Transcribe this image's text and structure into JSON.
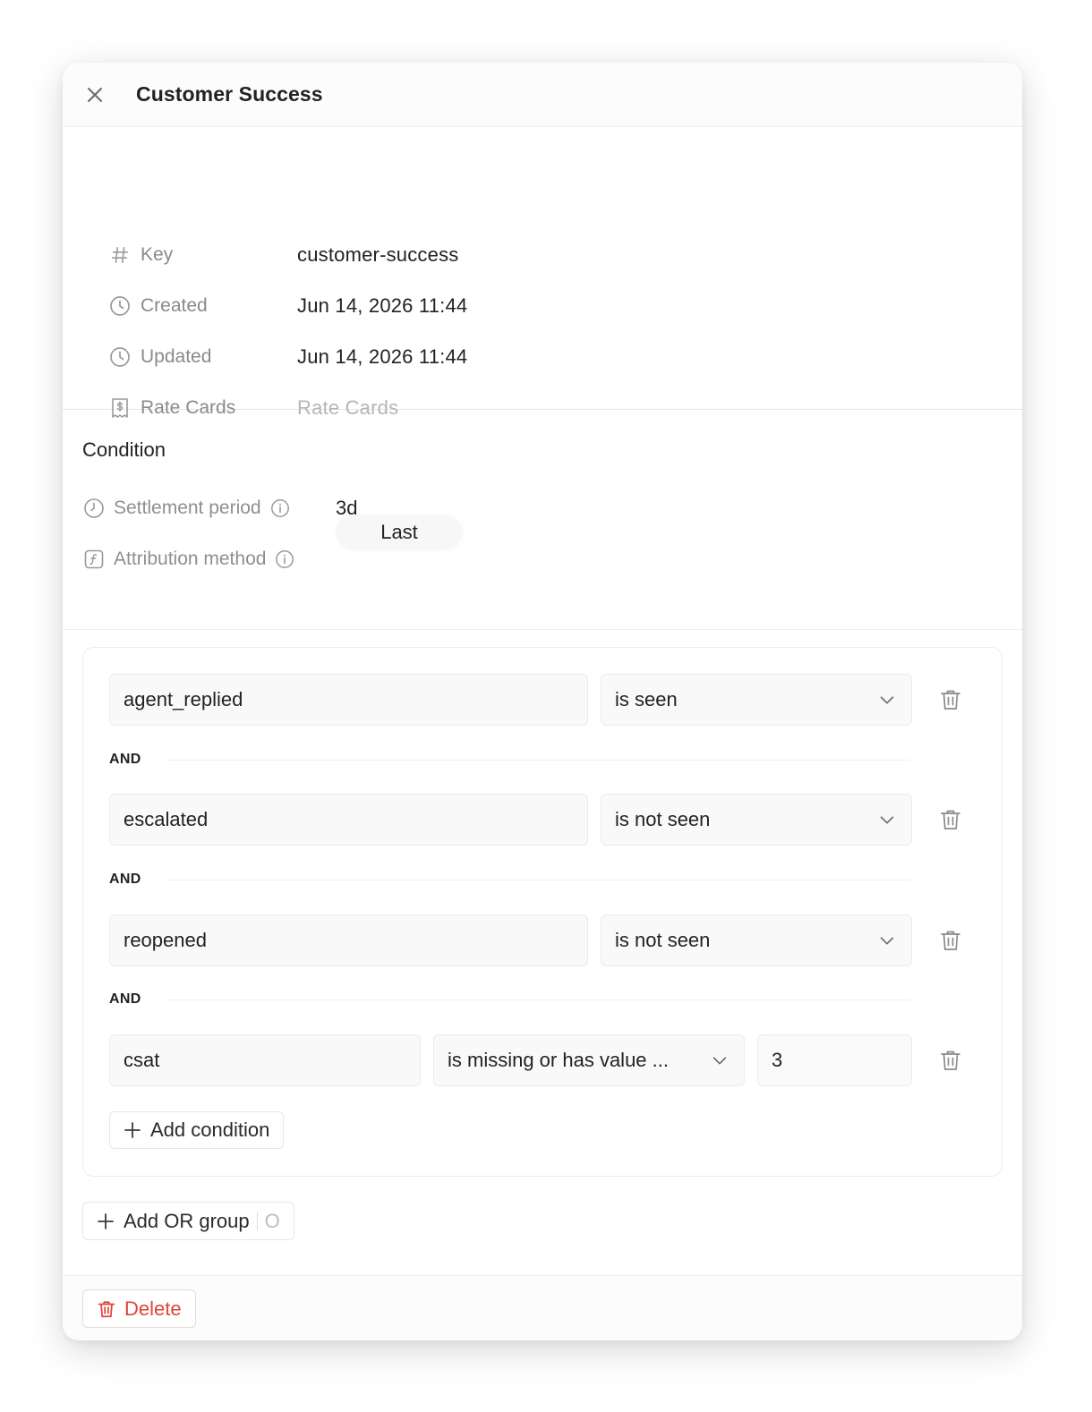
{
  "header": {
    "title": "Customer Success"
  },
  "meta": [
    {
      "icon": "hash-icon",
      "label": "Key",
      "value": "customer-success",
      "placeholder": false
    },
    {
      "icon": "clock-icon",
      "label": "Created",
      "value": "Jun 14, 2026 11:44",
      "placeholder": false
    },
    {
      "icon": "clock-icon",
      "label": "Updated",
      "value": "Jun 14, 2026 11:44",
      "placeholder": false
    },
    {
      "icon": "receipt-icon",
      "label": "Rate Cards",
      "value": "Rate Cards",
      "placeholder": true
    }
  ],
  "condition": {
    "title": "Condition",
    "settlement_label": "Settlement period",
    "settlement_value": "3d",
    "attribution_label": "Attribution method",
    "attribution_value": "Last"
  },
  "group": {
    "rows": [
      {
        "field": "agent_replied",
        "operator": "is seen",
        "value": null
      },
      {
        "field": "escalated",
        "operator": "is not seen",
        "value": null
      },
      {
        "field": "reopened",
        "operator": "is not seen",
        "value": null
      },
      {
        "field": "csat",
        "operator": "is missing or has value ...",
        "value": "3"
      }
    ],
    "and_label": "AND",
    "add_condition_label": "Add condition"
  },
  "add_or_group_label": "Add OR group",
  "add_or_group_shortcut": "O",
  "delete_label": "Delete",
  "colors": {
    "danger": "#e0443a",
    "muted": "#8a8a8a",
    "border": "#ececec"
  }
}
